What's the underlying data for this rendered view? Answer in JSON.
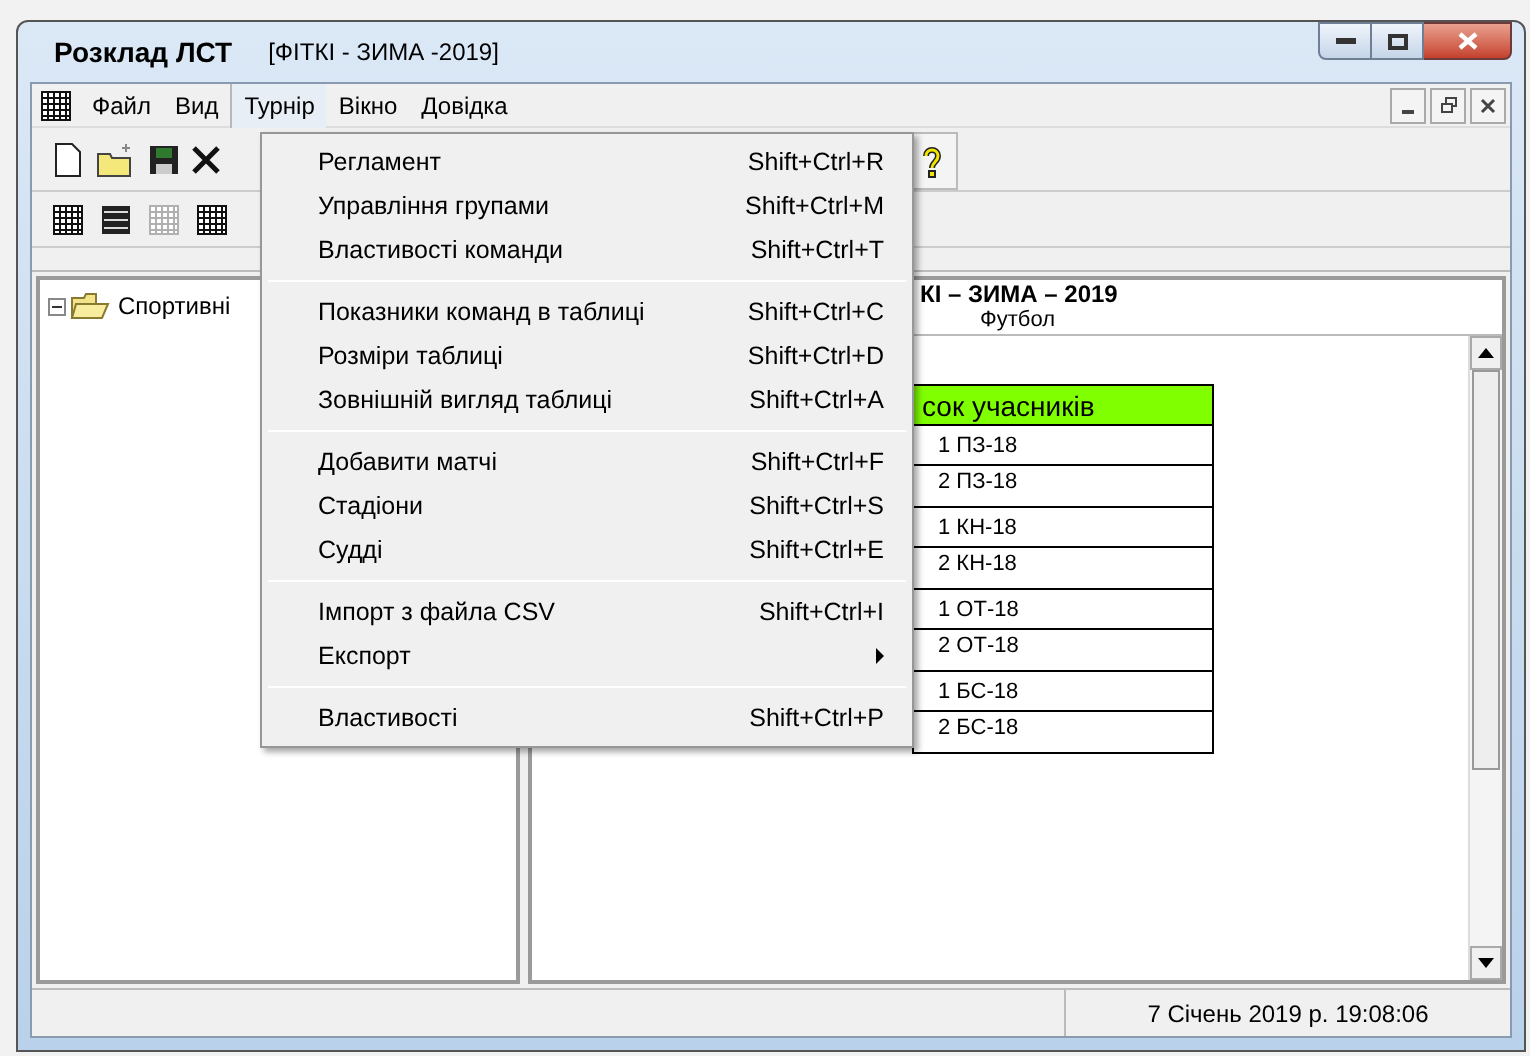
{
  "window": {
    "title": "Розклад ЛСТ",
    "document": "[ФІТКІ - ЗИМА -2019]"
  },
  "menu_bar": [
    {
      "label": "Файл",
      "selected": false
    },
    {
      "label": "Вид",
      "selected": false
    },
    {
      "label": "Турнір",
      "selected": true
    },
    {
      "label": "Вікно",
      "selected": false
    },
    {
      "label": "Довідка",
      "selected": false
    }
  ],
  "dropdown": [
    {
      "kind": "item",
      "label": "Регламент",
      "shortcut": "Shift+Ctrl+R"
    },
    {
      "kind": "item",
      "label": "Управління групами",
      "shortcut": "Shift+Ctrl+M"
    },
    {
      "kind": "item",
      "label": "Властивості команди",
      "shortcut": "Shift+Ctrl+T"
    },
    {
      "kind": "separator"
    },
    {
      "kind": "item",
      "label": "Показники команд в таблиці",
      "shortcut": "Shift+Ctrl+C"
    },
    {
      "kind": "item",
      "label": "Розміри таблиці",
      "shortcut": "Shift+Ctrl+D"
    },
    {
      "kind": "item",
      "label": "Зовнішній вигляд таблиці",
      "shortcut": "Shift+Ctrl+A"
    },
    {
      "kind": "separator"
    },
    {
      "kind": "item",
      "label": "Добавити матчі",
      "shortcut": "Shift+Ctrl+F"
    },
    {
      "kind": "item",
      "label": "Стадіони",
      "shortcut": "Shift+Ctrl+S"
    },
    {
      "kind": "item",
      "label": "Судді",
      "shortcut": "Shift+Ctrl+E"
    },
    {
      "kind": "separator"
    },
    {
      "kind": "item",
      "label": "Імпорт з файла CSV",
      "shortcut": "Shift+Ctrl+I"
    },
    {
      "kind": "submenu",
      "label": "Експорт"
    },
    {
      "kind": "separator"
    },
    {
      "kind": "item",
      "label": "Властивості",
      "shortcut": "Shift+Ctrl+P"
    }
  ],
  "tree": [
    {
      "label": "Спортивні",
      "expanded": true
    }
  ],
  "schedule": {
    "title": "КІ – ЗИМА – 2019",
    "subtitle": "Футбол",
    "header": "сок учасників",
    "groups": [
      {
        "teams": [
          "1 ПЗ-18",
          "2 ПЗ-18"
        ]
      },
      {
        "teams": [
          "1 КН-18",
          "2 КН-18"
        ]
      },
      {
        "teams": [
          "1 ОТ-18",
          "2 ОТ-18"
        ]
      },
      {
        "teams": [
          "1 БС-18",
          "2 БС-18"
        ]
      }
    ]
  },
  "status_bar": {
    "date": "7 Січень 2019 р. 19:08:06"
  }
}
